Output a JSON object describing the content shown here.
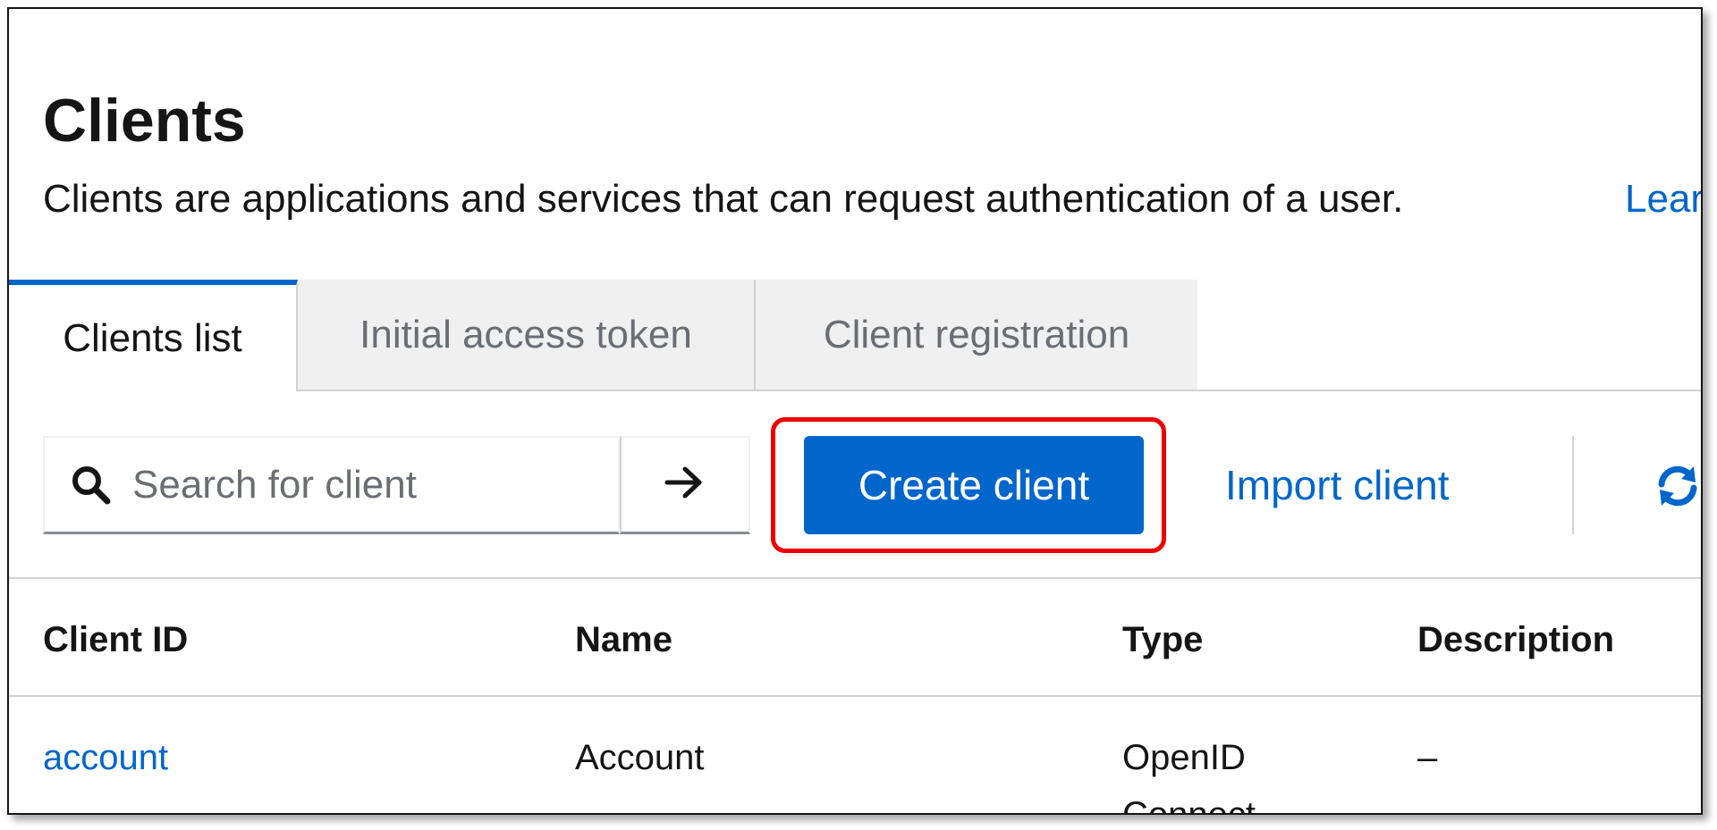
{
  "header": {
    "title": "Clients",
    "description": "Clients are applications and services that can request authentication of a user.",
    "learn_more": "Lear"
  },
  "tabs": [
    {
      "label": "Clients list",
      "active": true
    },
    {
      "label": "Initial access token",
      "active": false
    },
    {
      "label": "Client registration",
      "active": false
    }
  ],
  "toolbar": {
    "search_placeholder": "Search for client",
    "search_icon": "search-icon",
    "submit_icon": "arrow-right-icon",
    "create_label": "Create client",
    "import_label": "Import client",
    "refresh_icon": "refresh-icon"
  },
  "table": {
    "columns": [
      "Client ID",
      "Name",
      "Type",
      "Description"
    ],
    "rows": [
      {
        "client_id": "account",
        "name": "Account",
        "type": "OpenID Connect",
        "description": "–"
      }
    ]
  },
  "colors": {
    "primary": "#0066cc",
    "highlight": "#ee0000",
    "text": "#151515",
    "muted": "#6a6e73"
  }
}
